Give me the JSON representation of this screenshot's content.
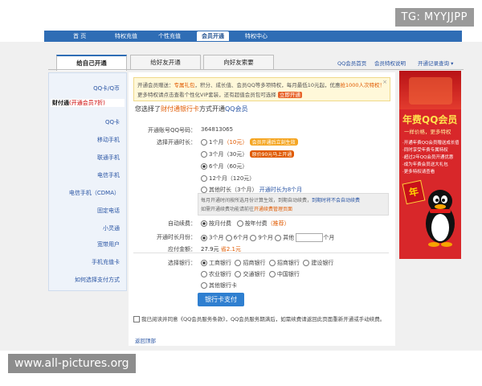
{
  "watermarks": {
    "top_right": "TG: MYYJJPP",
    "bottom_left": "www.all-pictures.org"
  },
  "nav": {
    "items": [
      "首 页",
      "特权充值",
      "个性充值",
      "会员开通",
      "特权中心"
    ],
    "active_index": 3
  },
  "tabs": [
    {
      "label": "给自己开通",
      "active": true
    },
    {
      "label": "给好友开通",
      "active": false
    },
    {
      "label": "向好友索要",
      "active": false
    }
  ],
  "top_links": [
    "QQ会员首页",
    "会员特权说明",
    "开通记录查询 ▾"
  ],
  "sidebar": {
    "items": [
      {
        "label": "QQ卡/Q币",
        "current": false
      },
      {
        "label": "财付通",
        "extra": "(开通会员7折)",
        "current": true
      },
      {
        "label": "QQ卡",
        "current": false
      },
      {
        "label": "移动手机",
        "current": false
      },
      {
        "label": "联通手机",
        "current": false
      },
      {
        "label": "电信手机",
        "current": false
      },
      {
        "label": "电信手机（CDMA）",
        "current": false
      },
      {
        "label": "固定电话",
        "current": false
      },
      {
        "label": "小灵通",
        "current": false
      },
      {
        "label": "宽带用户",
        "current": false
      },
      {
        "label": "手机充值卡",
        "current": false
      },
      {
        "label": "如何选择支付方式",
        "current": false
      }
    ]
  },
  "notice": {
    "line1_a": "开通会员赠送：",
    "line1_hl": "专属礼包",
    "line1_b": "，积分、成长值、会员QQ等多项特权，每月最低10元起，优惠",
    "line1_c": "抢1000人次特权！",
    "line2_a": "更多特权请点击查看个性化VIP套装",
    "line2_b": "，还有超值会员包可选择",
    "line2_btn": "立即开通",
    "close": "×"
  },
  "heading": {
    "prefix": "您选择了",
    "hl": "财付通银行卡",
    "mid": "方式开通",
    "blue": "QQ会员"
  },
  "form": {
    "qq_label": "开通账号QQ号码：",
    "qq_value": "364813065",
    "duration_label": "选择开通时长：",
    "durations": [
      {
        "label": "1个月",
        "note": "（10元）",
        "badge": "会员开通后立刻生效",
        "badge_type": "orange",
        "selected": false
      },
      {
        "label": "3个月",
        "note": "（30元）",
        "badge": "原价90元马上开通",
        "badge_type": "red",
        "selected": false
      },
      {
        "label": "6个月",
        "note": "（60元）",
        "badge": "",
        "badge_type": "",
        "selected": true
      },
      {
        "label": "12个月",
        "note": "（120元）",
        "badge": "",
        "badge_type": "",
        "selected": false
      },
      {
        "label": "其他时长",
        "note": "（3个月）",
        "badge": "开通时长为8个月",
        "badge_type": "link",
        "selected": false
      }
    ],
    "grey_note_l1": "每月开通时间按所选月份计算生效，到期自动续费，",
    "grey_note_b1": "到期时将不会自动续费",
    "grey_note_l2": "如需开通续费功能请前往",
    "grey_note_r2": "开通续费管理页面",
    "autorenew_label": "自动续费：",
    "autorenew_opts": [
      {
        "label": "按月付费",
        "selected": true
      },
      {
        "label": "按年付费",
        "selected": false,
        "extra": "（推荐）"
      }
    ],
    "period_label": "开通时长月份：",
    "periods": [
      {
        "label": "3个月",
        "selected": true
      },
      {
        "label": "6个月",
        "selected": false
      },
      {
        "label": "9个月",
        "selected": false
      },
      {
        "label": "其他",
        "selected": false
      }
    ],
    "period_unit": "个月",
    "price_label": "应付金额：",
    "price_value": "27.9元",
    "price_save": "省2.1元",
    "bank_label": "选择银行：",
    "banks_row1": [
      "工商银行",
      "招商银行",
      "招商银行",
      "建设银行"
    ],
    "banks_row2": [
      "农业银行",
      "交通银行",
      "中国银行"
    ],
    "banks_row3": [
      "其他银行卡"
    ],
    "pay_button": "银行卡支付",
    "agree_text": "我已阅读并同意《QQ会员服务条款》，QQ会员服务期满后，如需续费请返回此页面重新开通或手动续费。",
    "foot_link": "返回顶部"
  },
  "ad": {
    "title": "年费QQ会员",
    "sub": "一样价格，更多特权",
    "bullets": [
      "·开通年费QQ会员赠送成长值",
      "·同时享受年费专属特权",
      "·超过2年QQ会员开通优惠",
      "·成为年费会员送大礼包",
      "·更多特权请查看"
    ],
    "stamp": "年"
  }
}
